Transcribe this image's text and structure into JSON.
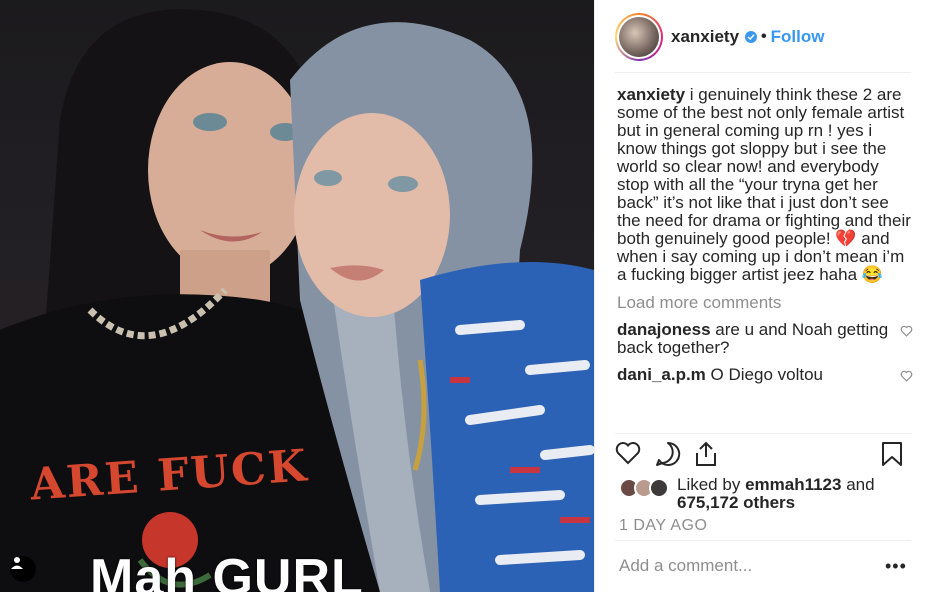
{
  "post": {
    "username": "xanxiety",
    "follow_label": "Follow",
    "separator": "•",
    "photo_caption_text": "Mah GURL",
    "shirt_text": "ARE FUCK"
  },
  "caption": {
    "author": "xanxiety",
    "text": "i genuinely think these 2 are some of the best not only female artist but in general coming up rn ! yes i know things got sloppy but i see the world so clear now! and everybody stop with all the “your tryna get her back” it’s not like that i just don’t see the need for drama or fighting and their both genuinely good people! 💔  and when i say coming up i don’t mean i’m a fucking bigger artist jeez haha 😂"
  },
  "comments": {
    "load_more_label": "Load more comments",
    "items": [
      {
        "author": "danajoness",
        "text": "are u and Noah getting back together?"
      },
      {
        "author": "dani_a.p.m",
        "text": "O Diego voltou"
      }
    ]
  },
  "likes": {
    "prefix": "Liked by",
    "user": "emmah1123",
    "and": "and",
    "others": "675,172 others"
  },
  "timestamp": "1 DAY AGO",
  "add_comment_placeholder": "Add a comment...",
  "more_options": "•••",
  "icons": {
    "like": "heart-icon",
    "comment": "comment-icon",
    "share": "share-icon",
    "save": "bookmark-icon",
    "tag": "user-tag-icon",
    "verified": "verified-badge-icon"
  },
  "colors": {
    "accent": "#3897f0",
    "muted": "#8e8e8e",
    "text": "#262626"
  }
}
